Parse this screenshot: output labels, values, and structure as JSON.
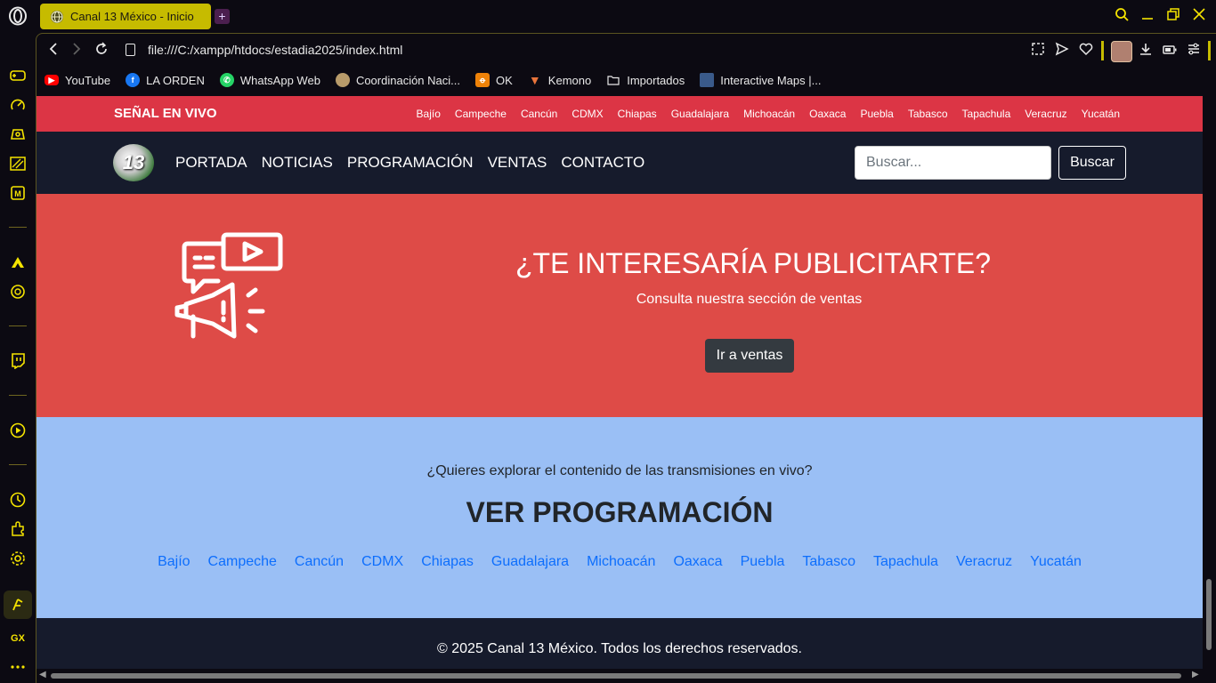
{
  "browser": {
    "tab_title": "Canal 13 México - Inicio",
    "new_tab": "+",
    "url": "file:///C:/xampp/htdocs/estadia2025/index.html",
    "bookmarks": [
      {
        "label": "YouTube",
        "icon": "youtube-icon",
        "color": "#ff0000"
      },
      {
        "label": "LA ORDEN",
        "icon": "facebook-icon",
        "color": "#1877f2"
      },
      {
        "label": "WhatsApp Web",
        "icon": "whatsapp-icon",
        "color": "#25d366"
      },
      {
        "label": "Coordinación Naci...",
        "icon": "seal-icon",
        "color": "#b89b6a"
      },
      {
        "label": "OK",
        "icon": "odnoklassniki-icon",
        "color": "#ee8208"
      },
      {
        "label": "Kemono",
        "icon": "kemono-icon",
        "color": "#e8743b"
      },
      {
        "label": "Importados",
        "icon": "folder-icon",
        "color": "#e8e8e8"
      },
      {
        "label": "Interactive Maps |...",
        "icon": "map-icon",
        "color": "#3a5a8a"
      }
    ]
  },
  "site": {
    "live_label": "SEÑAL EN VIVO",
    "top_regions": [
      "Bajío",
      "Campeche",
      "Cancún",
      "CDMX",
      "Chiapas",
      "Guadalajara",
      "Michoacán",
      "Oaxaca",
      "Puebla",
      "Tabasco",
      "Tapachula",
      "Veracruz",
      "Yucatán"
    ],
    "logo_text": "13",
    "nav": [
      "PORTADA",
      "NOTICIAS",
      "PROGRAMACIÓN",
      "VENTAS",
      "CONTACTO"
    ],
    "search_placeholder": "Buscar...",
    "search_button": "Buscar",
    "promo": {
      "title": "¿TE INTERESARÍA PUBLICITARTE?",
      "subtitle": "Consulta nuestra sección de ventas",
      "button": "Ir a ventas"
    },
    "programming": {
      "question": "¿Quieres explorar el contenido de las transmisiones en vivo?",
      "title": "VER PROGRAMACIÓN",
      "regions": [
        "Bajío",
        "Campeche",
        "Cancún",
        "CDMX",
        "Chiapas",
        "Guadalajara",
        "Michoacán",
        "Oaxaca",
        "Puebla",
        "Tabasco",
        "Tapachula",
        "Veracruz",
        "Yucatán"
      ]
    },
    "footer": "© 2025 Canal 13 México. Todos los derechos reservados."
  },
  "colors": {
    "accent": "#c6bb00",
    "topbar": "#dc3545",
    "nav_bg": "#161b2c",
    "promo_bg": "#de4b47",
    "programming_bg": "#9abff5",
    "link": "#0d6efd"
  }
}
